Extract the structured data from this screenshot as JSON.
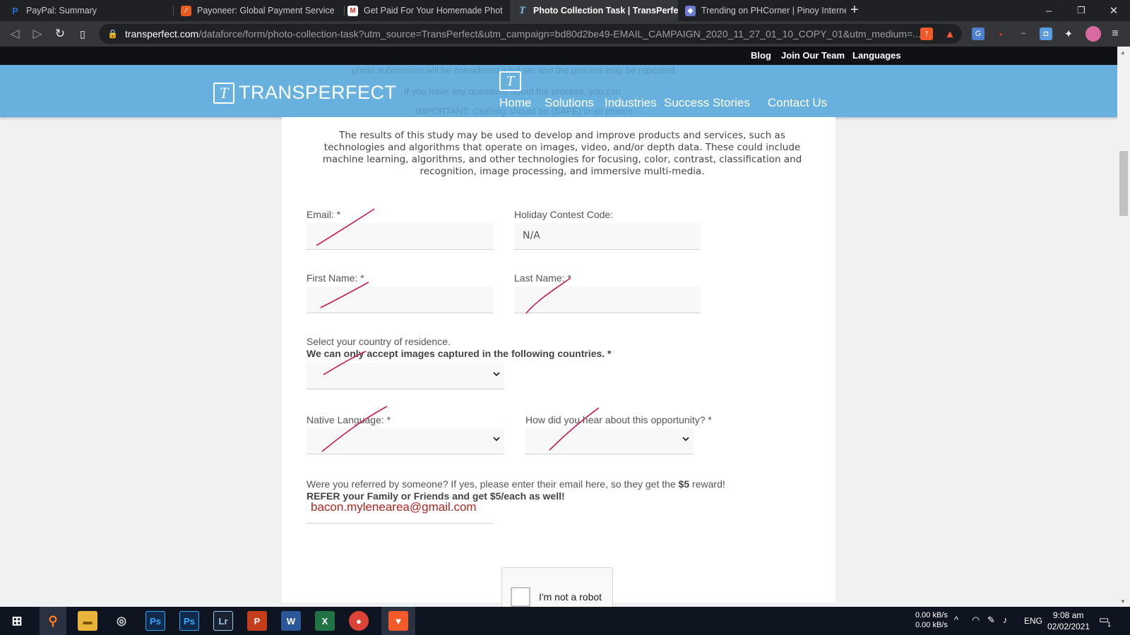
{
  "browser": {
    "tabs": [
      {
        "title": "PayPal: Summary",
        "icon": "paypal-icon"
      },
      {
        "title": "Payoneer: Global Payment Service",
        "icon": "payoneer-icon"
      },
      {
        "title": "Get Paid For Your Homemade Phot",
        "icon": "gmail-icon"
      },
      {
        "title": "Photo Collection Task | TransPerfe",
        "icon": "transperfect-icon"
      },
      {
        "title": "Trending on PHCorner | Pinoy Internet",
        "icon": "phcorner-icon"
      }
    ],
    "url_host": "transperfect.com",
    "url_path": "/dataforce/form/photo-collection-task?utm_source=TransPerfect&utm_campaign=bd80d2be49-EMAIL_CAMPAIGN_2020_11_27_01_10_COPY_01&utm_medium=...",
    "brave_badge": "7"
  },
  "site": {
    "util_links": [
      "Blog",
      "Join Our Team",
      "Languages"
    ],
    "logo_text": "TRANSPERFECT",
    "nav": [
      "Home",
      "Solutions",
      "Industries",
      "Success Stories",
      "Contact Us"
    ],
    "ghost_lines": [
      "photo submission will be considered a full set and the process may be repeated.",
      "If you have any questions about the process, you can",
      "IMPORTANT: Clothing should be (SAFE) in all photos"
    ]
  },
  "form": {
    "intro": "The results of this study may be used to develop and improve products and services, such as technologies and algorithms that operate on images, video, and/or depth data. These could include machine learning, algorithms, and other technologies for focusing, color, contrast, classification and recognition, image processing, and immersive multi-media.",
    "email_label": "Email: *",
    "holiday_label": "Holiday Contest Code:",
    "holiday_value": "N/A",
    "first_name_label": "First Name: *",
    "last_name_label": "Last Name: *",
    "country_label": "Select your country of residence.",
    "country_note": "We can only accept images captured in the following countries. *",
    "language_label": "Native Language: *",
    "hear_label": "How did you hear about this opportunity? *",
    "referral_pre": "Were you referred by someone? If yes, please enter their email here, so they get the ",
    "referral_amount": "$5",
    "referral_post": " reward!",
    "referral_note": "REFER your Family or Friends and get $5/each as well!",
    "referral_value": "bacon.mylenearea@gmail.com",
    "captcha_label": "I'm not a robot"
  },
  "taskbar": {
    "net_up": "0.00 kB/s",
    "net_down": "0.00 kB/s",
    "lang": "ENG",
    "time": "9:08 am",
    "date": "02/02/2021",
    "notifications": "1"
  },
  "colors": {
    "header_blue": "#68b1df",
    "annotation_red": "#c8194a",
    "referral_red": "#b0261e"
  }
}
